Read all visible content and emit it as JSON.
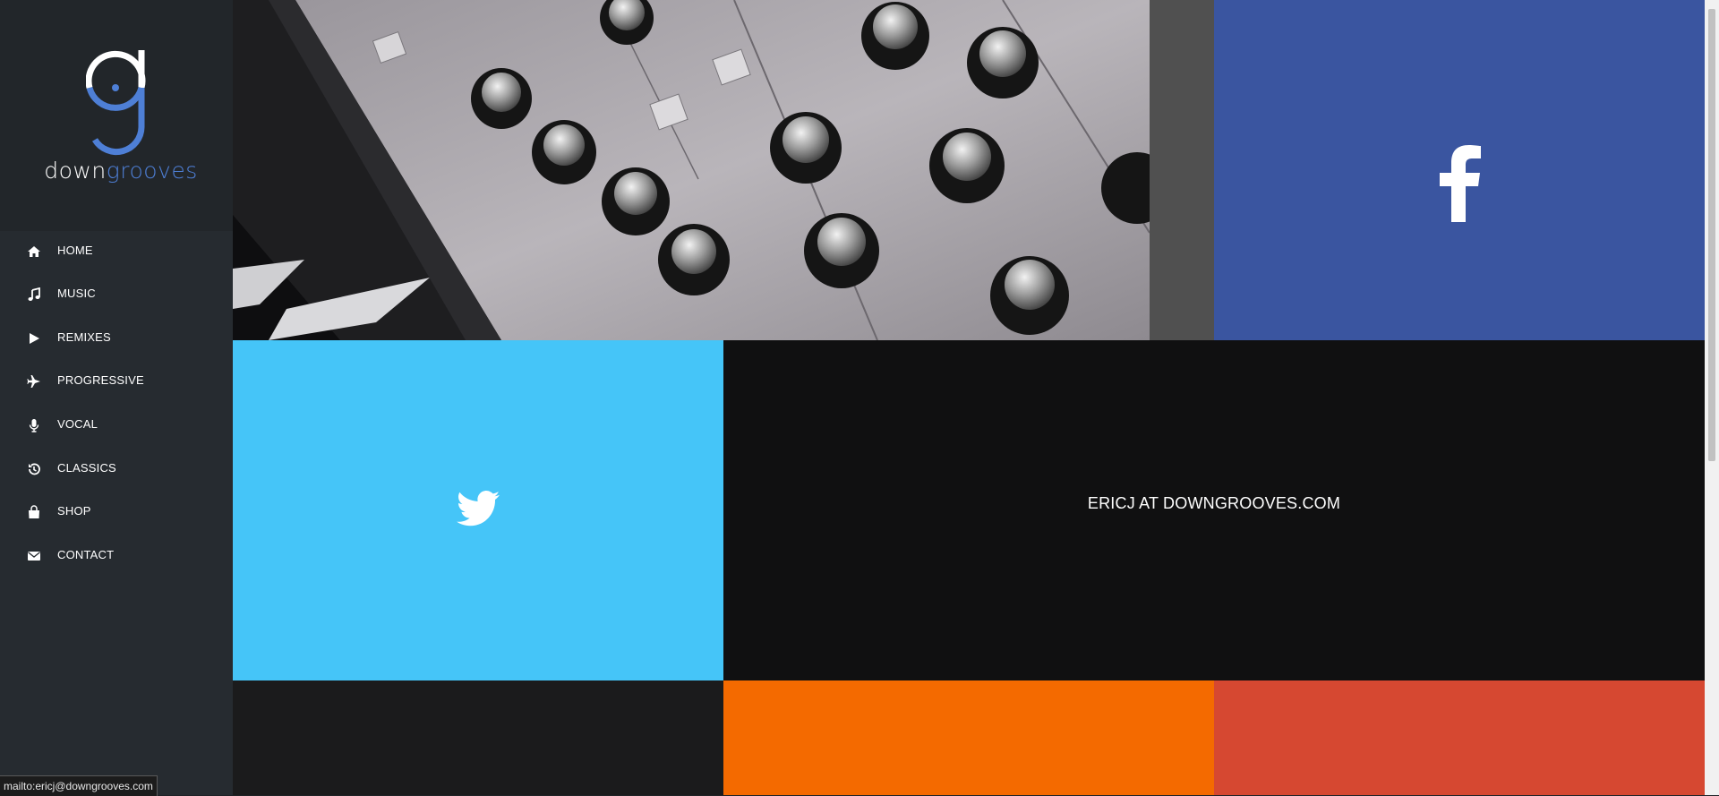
{
  "brand": {
    "name_part1": "down",
    "name_part2": "grooves"
  },
  "nav": [
    {
      "label": "HOME",
      "icon": "home-icon"
    },
    {
      "label": "MUSIC",
      "icon": "music-note-icon"
    },
    {
      "label": "REMIXES",
      "icon": "play-icon"
    },
    {
      "label": "PROGRESSIVE",
      "icon": "plane-icon"
    },
    {
      "label": "VOCAL",
      "icon": "microphone-icon"
    },
    {
      "label": "CLASSICS",
      "icon": "history-icon"
    },
    {
      "label": "SHOP",
      "icon": "shopping-bag-icon"
    },
    {
      "label": "CONTACT",
      "icon": "envelope-icon"
    }
  ],
  "tiles": {
    "facebook_icon": "facebook-icon",
    "twitter_icon": "twitter-icon",
    "email_text": "ERICJ AT DOWNGROOVES.COM"
  },
  "status_bar": {
    "url": "mailto:ericj@downgrooves.com"
  },
  "colors": {
    "sidebar": "#262b30",
    "facebook": "#3a55a0",
    "twitter": "#45c5f8",
    "email_tile": "#101011",
    "orange_tile": "#f46a00",
    "red_tile": "#d64831",
    "brand_blue": "#4e7fd6"
  }
}
